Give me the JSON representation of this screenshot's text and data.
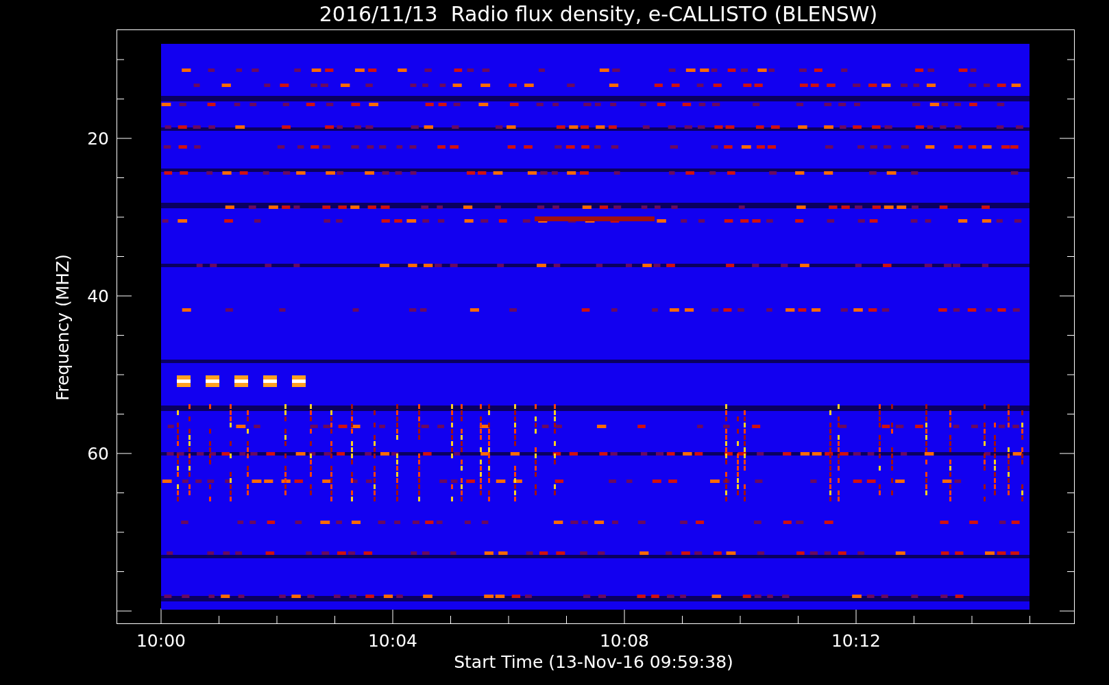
{
  "title": "2016/11/13  Radio flux density, e-CALLISTO (BLENSW)",
  "y_axis": {
    "label": "Frequency (MHZ)",
    "ticks": [
      "20",
      "40",
      "60"
    ]
  },
  "x_axis": {
    "label": "Start Time (13-Nov-16 09:59:38)",
    "ticks": [
      "10:00",
      "10:04",
      "10:08",
      "10:12"
    ]
  }
}
